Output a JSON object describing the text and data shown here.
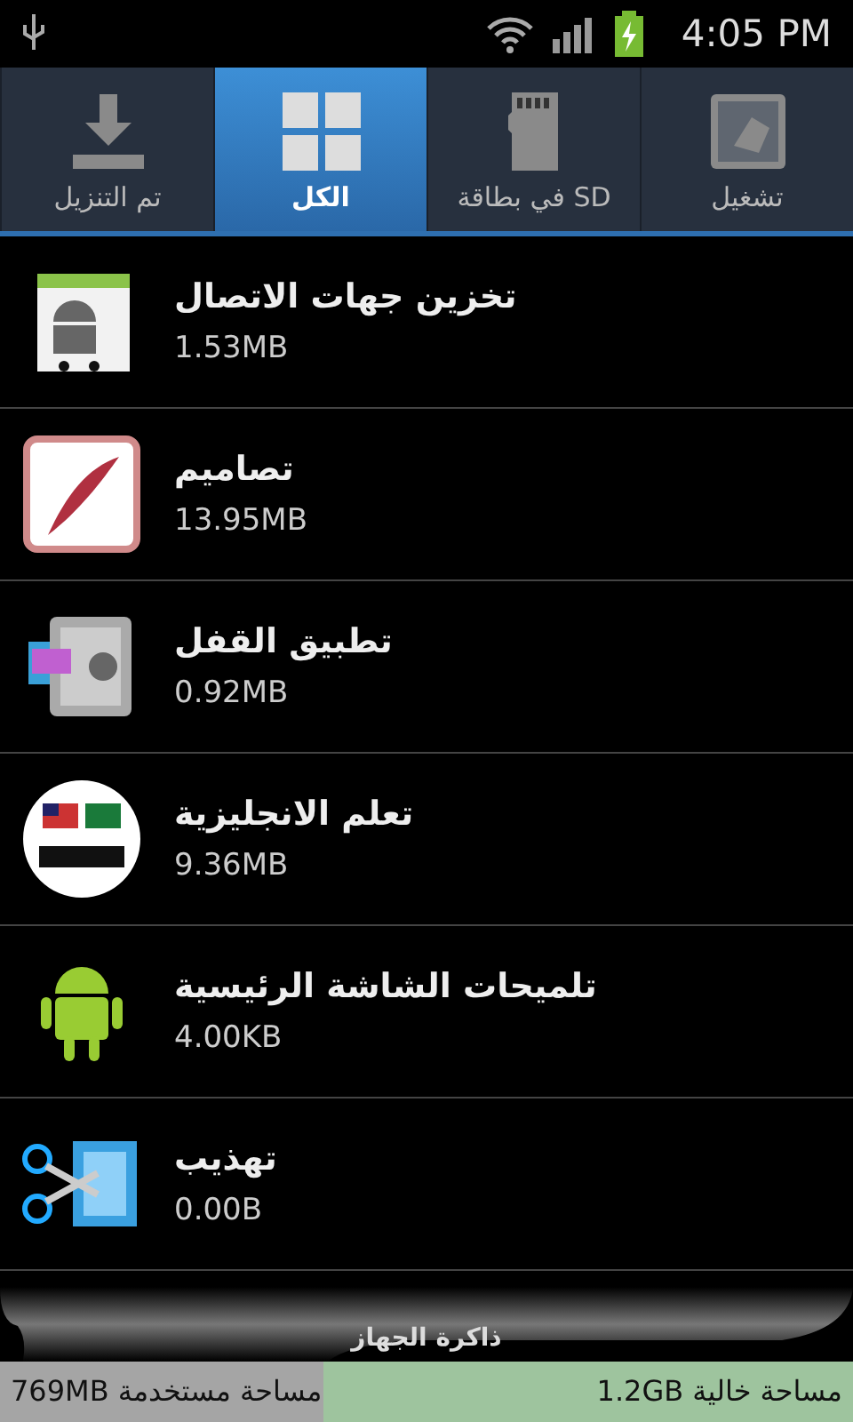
{
  "status_bar": {
    "time": "4:05 PM"
  },
  "tabs": [
    {
      "label": "تشغيل",
      "selected": false
    },
    {
      "label": "في بطاقة SD",
      "selected": false
    },
    {
      "label": "الكل",
      "selected": true
    },
    {
      "label": "تم التنزيل",
      "selected": false
    }
  ],
  "apps": [
    {
      "name": "تخزين جهات الاتصال",
      "size": "1.53MB"
    },
    {
      "name": "تصاميم",
      "size": "13.95MB"
    },
    {
      "name": "تطبيق القفل",
      "size": "0.92MB"
    },
    {
      "name": "تعلم الانجليزية",
      "size": "9.36MB"
    },
    {
      "name": "تلميحات الشاشة الرئيسية",
      "size": "4.00KB"
    },
    {
      "name": "تهذيب",
      "size": "0.00B"
    }
  ],
  "storage": {
    "title": "ذاكرة الجهاز",
    "used": "769MB مساحة مستخدمة",
    "free": "1.2GB مساحة خالية",
    "level": 0.38
  }
}
